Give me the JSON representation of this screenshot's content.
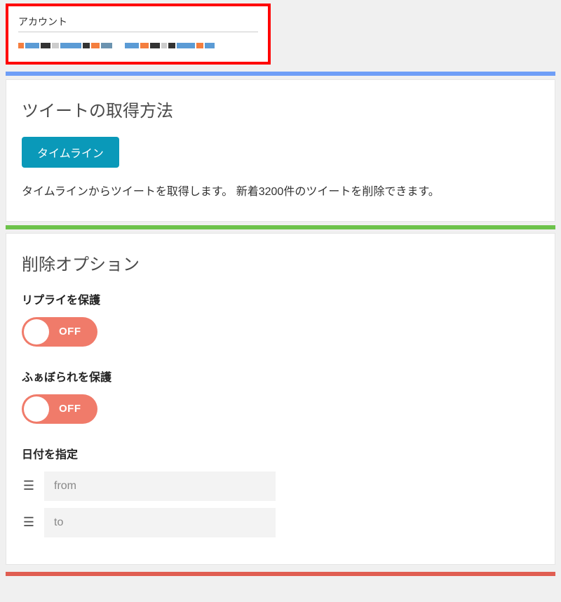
{
  "account": {
    "heading": "アカウント"
  },
  "tweet_method": {
    "title": "ツイートの取得方法",
    "button": "タイムライン",
    "description": "タイムラインからツイートを取得します。 新着3200件のツイートを削除できます。"
  },
  "delete_options": {
    "title": "削除オプション",
    "protect_reply": {
      "label": "リプライを保護",
      "state": "OFF"
    },
    "protect_fav": {
      "label": "ふぁぼられを保護",
      "state": "OFF"
    },
    "date_spec": {
      "label": "日付を指定",
      "from_placeholder": "from",
      "to_placeholder": "to"
    }
  }
}
